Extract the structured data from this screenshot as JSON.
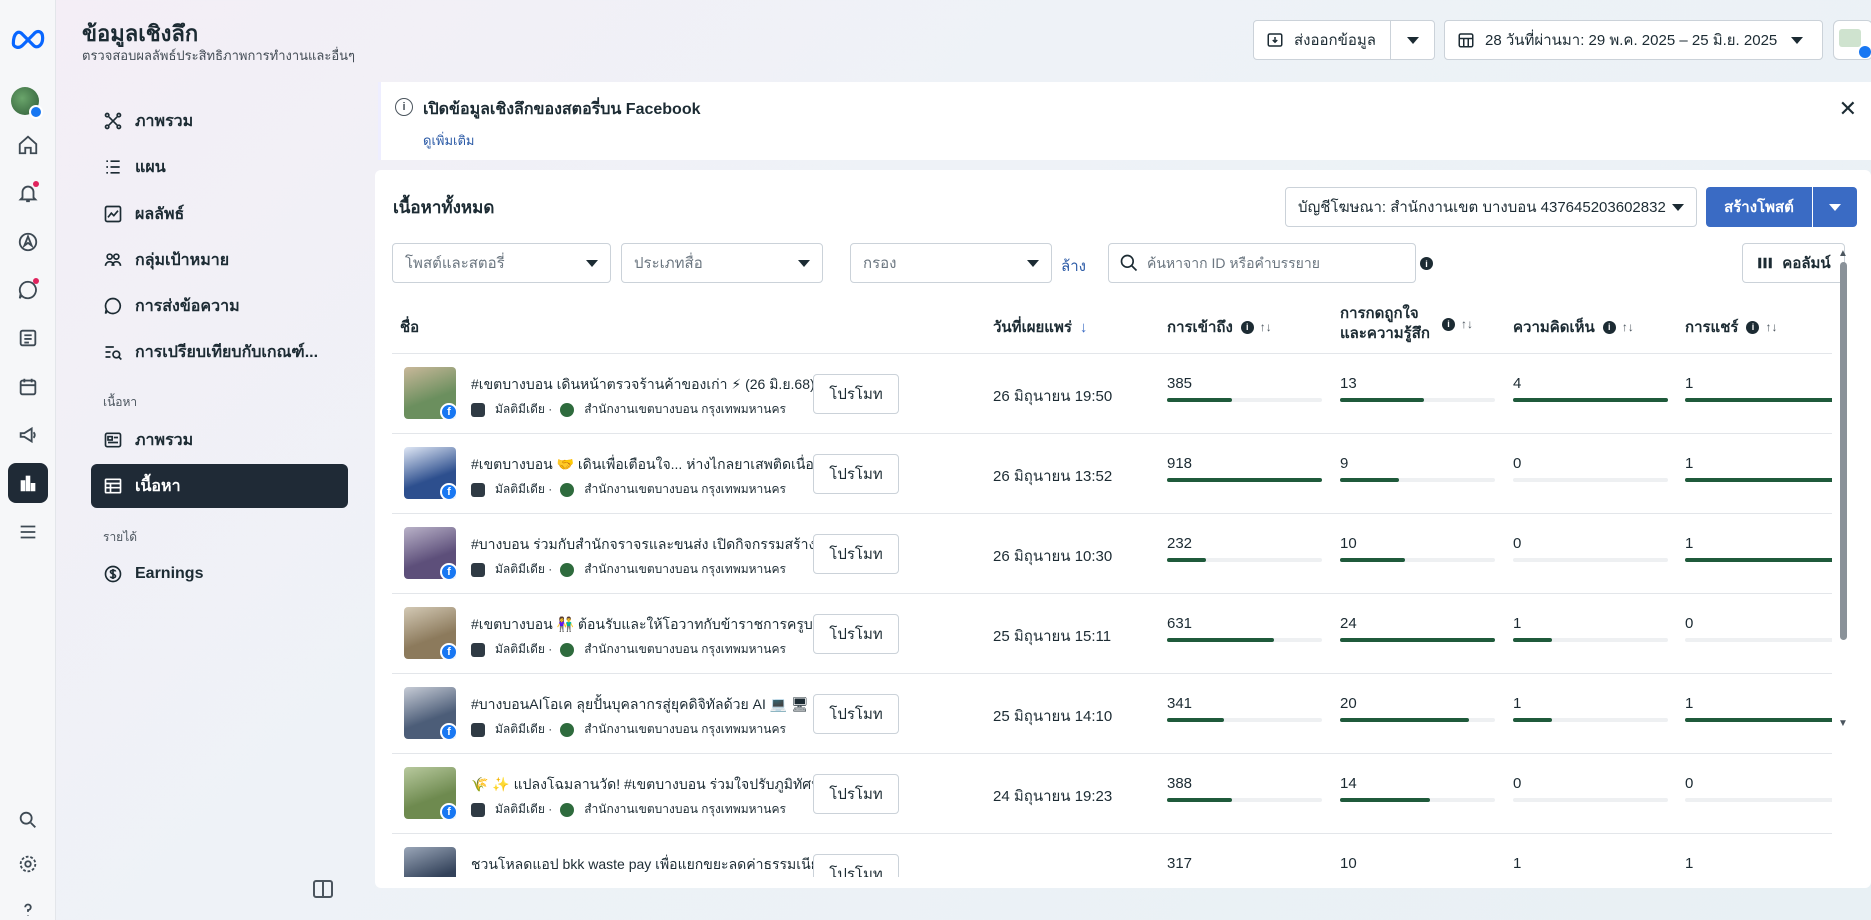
{
  "header": {
    "title": "ข้อมูลเชิงลึก",
    "subtitle": "ตรวจสอบผลลัพธ์ประสิทธิภาพการทำงานและอื่นๆ",
    "export_label": "ส่งออกข้อมูล",
    "date_range_label": "28 วันที่ผ่านมา: 29 พ.ค. 2025 – 25 มิ.ย. 2025"
  },
  "nav": {
    "items": [
      {
        "label": "ภาพรวม",
        "icon": "overview-icon"
      },
      {
        "label": "แผน",
        "icon": "list-icon"
      },
      {
        "label": "ผลลัพธ์",
        "icon": "chart-line-icon"
      },
      {
        "label": "กลุ่มเป้าหมาย",
        "icon": "people-icon"
      },
      {
        "label": "การส่งข้อความ",
        "icon": "chat-icon"
      },
      {
        "label": "การเปรียบเทียบกับเกณฑ์...",
        "icon": "compare-icon"
      }
    ],
    "content_section": "เนื้อหา",
    "content_items": [
      {
        "label": "ภาพรวม",
        "icon": "content-overview-icon"
      },
      {
        "label": "เนื้อหา",
        "icon": "table-icon"
      }
    ],
    "revenue_section": "รายได้",
    "earnings_label": "Earnings"
  },
  "banner": {
    "title": "เปิดข้อมูลเชิงลึกของสตอรี่บน Facebook",
    "link": "ดูเพิ่มเติม"
  },
  "panel": {
    "title": "เนื้อหาทั้งหมด",
    "account_select": "บัญชีโฆษณา: สำนักงานเขต บางบอน 437645203602832",
    "create_label": "สร้างโพสต์",
    "filters": [
      "โพสต์และสตอรี่",
      "ประเภทสื่อ",
      "กรอง"
    ],
    "clear_label": "ล้าง",
    "search_placeholder": "ค้นหาจาก ID หรือคำบรรยาย",
    "columns_label": "คอลัมน์"
  },
  "table": {
    "headers": {
      "name": "ชื่อ",
      "date": "วันที่เผยแพร่",
      "reach": "การเข้าถึง",
      "reactions_line1": "การกดถูกใจ",
      "reactions_line2": "และความรู้สึก",
      "comments": "ความคิดเห็น",
      "shares": "การแชร์"
    },
    "meta_type": "มัลติมีเดีย ·",
    "page_name": "สำนักงานเขตบางบอน กรุงเทพมหานคร",
    "promote_label": "โปรโมท",
    "rows": [
      {
        "title": "#เขตบางบอน เดินหน้าตรวจร้านค้าของเก่า ⚡ (26 มิ.ย.68) ...",
        "date": "26 มิถุนายน 19:50",
        "reach": "385",
        "reactions": "13",
        "comments": "4",
        "shares": "1",
        "reach_frac": 0.42,
        "reactions_frac": 0.54,
        "comments_frac": 1.0,
        "shares_frac": 1.0
      },
      {
        "title": "#เขตบางบอน 🤝 เดินเพื่อเตือนใจ... ห่างไกลยาเสพติดเนื่องใ...",
        "date": "26 มิถุนายน 13:52",
        "reach": "918",
        "reactions": "9",
        "comments": "0",
        "shares": "1",
        "reach_frac": 1.0,
        "reactions_frac": 0.38,
        "comments_frac": 0,
        "shares_frac": 1.0
      },
      {
        "title": "#บางบอน ร่วมกับสำนักจราจรและขนส่ง เปิดกิจกรรมสร้างควา...",
        "date": "26 มิถุนายน 10:30",
        "reach": "232",
        "reactions": "10",
        "comments": "0",
        "shares": "1",
        "reach_frac": 0.25,
        "reactions_frac": 0.42,
        "comments_frac": 0,
        "shares_frac": 1.0
      },
      {
        "title": "#เขตบางบอน 👫 ต้อนรับและให้โอวาทกับข้าราชการครูบรรจุ...",
        "date": "25 มิถุนายน 15:11",
        "reach": "631",
        "reactions": "24",
        "comments": "1",
        "shares": "0",
        "reach_frac": 0.69,
        "reactions_frac": 1.0,
        "comments_frac": 0.25,
        "shares_frac": 0
      },
      {
        "title": "#บางบอนAIโอเค ลุยปั้นบุคลากรสู่ยุคดิจิทัลด้วย AI 💻 🖥 ...",
        "date": "25 มิถุนายน 14:10",
        "reach": "341",
        "reactions": "20",
        "comments": "1",
        "shares": "1",
        "reach_frac": 0.37,
        "reactions_frac": 0.83,
        "comments_frac": 0.25,
        "shares_frac": 1.0
      },
      {
        "title": "🌾 ✨ แปลงโฉมลานวัด! #เขตบางบอน ร่วมใจปรับภูมิทัศน์ ณ...",
        "date": "24 มิถุนายน 19:23",
        "reach": "388",
        "reactions": "14",
        "comments": "0",
        "shares": "0",
        "reach_frac": 0.42,
        "reactions_frac": 0.58,
        "comments_frac": 0,
        "shares_frac": 0
      },
      {
        "title": "ชวนโหลดแอป bkk waste pay เพื่อแยกขยะลดค่าธรรมเนียม...",
        "date": "",
        "reach": "317",
        "reactions": "10",
        "comments": "1",
        "shares": "1",
        "reach_frac": 0.35,
        "reactions_frac": 0.42,
        "comments_frac": 0.25,
        "shares_frac": 1.0
      }
    ]
  },
  "colors": {
    "accent": "#3a6bc4",
    "bar": "#1f5a3b",
    "nav_active": "#1f2a36",
    "meta_blue": "#1877f2"
  }
}
